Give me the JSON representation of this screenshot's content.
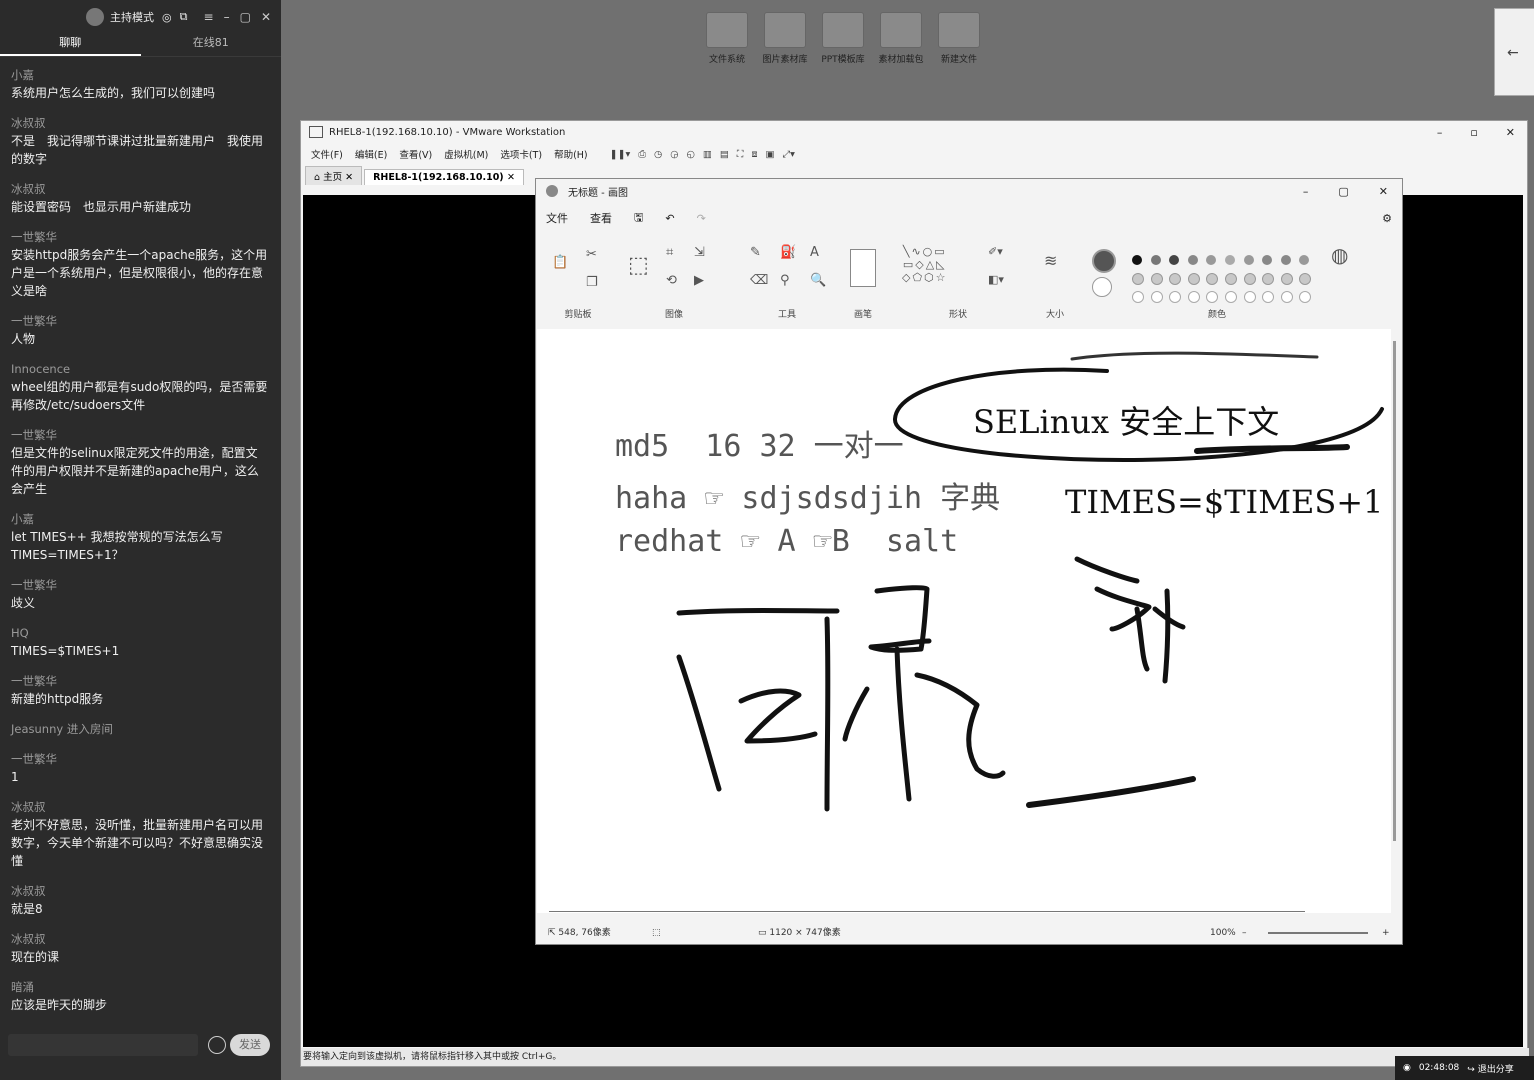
{
  "chat": {
    "title": "主持模式",
    "tabs": [
      "聊聊",
      "在线81"
    ],
    "messages": [
      {
        "name": "小嘉",
        "text": "系统用户怎么生成的，我们可以创建吗"
      },
      {
        "name": "冰叔叔",
        "text": "不是　我记得哪节课讲过批量新建用户　我使用的数字"
      },
      {
        "name": "冰叔叔",
        "text": "能设置密码　也显示用户新建成功"
      },
      {
        "name": "一世繁华",
        "text": "安装httpd服务会产生一个apache服务，这个用户是一个系统用户，但是权限很小，他的存在意义是啥"
      },
      {
        "name": "一世繁华",
        "text": "人物"
      },
      {
        "name": "Innocence",
        "text": "wheel组的用户都是有sudo权限的吗，是否需要再修改/etc/sudoers文件"
      },
      {
        "name": "一世繁华",
        "text": "但是文件的selinux限定死文件的用途，配置文件的用户权限并不是新建的apache用户，这么会产生"
      },
      {
        "name": "小嘉",
        "text": "let TIMES++ 我想按常规的写法怎么写 TIMES=TIMES+1？"
      },
      {
        "name": "一世繁华",
        "text": "歧义"
      },
      {
        "name": "HQ",
        "text": "TIMES=$TIMES+1"
      },
      {
        "name": "一世繁华",
        "text": "新建的httpd服务"
      }
    ],
    "system_message": "Jeasunny 进入房间",
    "messages2": [
      {
        "name": "一世繁华",
        "text": "1"
      },
      {
        "name": "冰叔叔",
        "text": "老刘不好意思，没听懂，批量新建用户名可以用数字，今天单个新建不可以吗？不好意思确实没懂"
      },
      {
        "name": "冰叔叔",
        "text": "就是8"
      },
      {
        "name": "冰叔叔",
        "text": "现在的课"
      },
      {
        "name": "暗涌",
        "text": "应该是昨天的脚步"
      }
    ],
    "send_label": "发送"
  },
  "desktop": {
    "icons": [
      "文件系统",
      "图片素材库",
      "PPT模板库",
      "素材加载包",
      "新建文件"
    ]
  },
  "vmware": {
    "title": "RHEL8-1(192.168.10.10) - VMware Workstation",
    "menu": [
      "文件(F)",
      "编辑(E)",
      "查看(V)",
      "虚拟机(M)",
      "选项卡(T)",
      "帮助(H)"
    ],
    "tabs": [
      "主页",
      "RHEL8-1(192.168.10.10)"
    ],
    "status": "要将输入定向到该虚拟机，请将鼠标指针移入其中或按 Ctrl+G。"
  },
  "paint": {
    "title": "无标题 - 画图",
    "menu": [
      "文件",
      "查看"
    ],
    "groups": [
      "剪贴板",
      "图像",
      "工具",
      "画笔",
      "形状",
      "大小",
      "颜色"
    ],
    "canvas_text": {
      "line1": "md5  16 32 一对一",
      "line2": "haha ☞ sdjsdsdjih 字典",
      "line3": "redhat ☞ A ☞B  salt",
      "selinux": "SELinux 安全上下文",
      "times": "TIMES=$TIMES+1"
    },
    "status": {
      "cursor": "548, 76像素",
      "size": "1120 × 747像素",
      "zoom": "100%"
    }
  },
  "taskbar": {
    "time": "02:48:08",
    "exit_share": "退出分享"
  }
}
